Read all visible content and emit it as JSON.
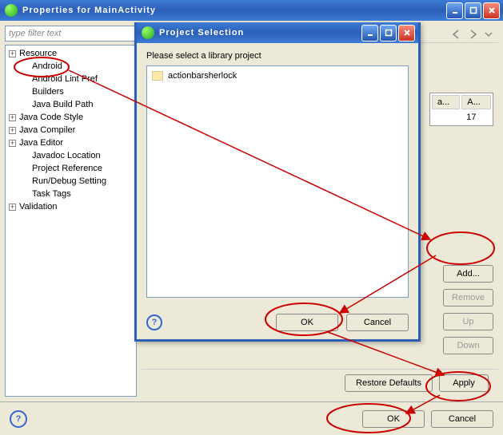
{
  "outer": {
    "title": "Properties for MainActivity",
    "filter_placeholder": "type filter text",
    "tree": [
      {
        "label": "Resource",
        "expandable": true,
        "child": false
      },
      {
        "label": "Android",
        "expandable": false,
        "child": true
      },
      {
        "label": "Android Lint Pref",
        "expandable": false,
        "child": true
      },
      {
        "label": "Builders",
        "expandable": false,
        "child": true
      },
      {
        "label": "Java Build Path",
        "expandable": false,
        "child": true
      },
      {
        "label": "Java Code Style",
        "expandable": true,
        "child": false
      },
      {
        "label": "Java Compiler",
        "expandable": true,
        "child": false
      },
      {
        "label": "Java Editor",
        "expandable": true,
        "child": false
      },
      {
        "label": "Javadoc Location",
        "expandable": false,
        "child": true
      },
      {
        "label": "Project Reference",
        "expandable": false,
        "child": true
      },
      {
        "label": "Run/Debug Setting",
        "expandable": false,
        "child": true
      },
      {
        "label": "Task Tags",
        "expandable": false,
        "child": true
      },
      {
        "label": "Validation",
        "expandable": true,
        "child": false
      }
    ],
    "table": {
      "col1": "a...",
      "col2": "A...",
      "row1": "17"
    },
    "side_buttons": {
      "add": "Add...",
      "remove": "Remove",
      "up": "Up",
      "down": "Down"
    },
    "restore_defaults": "Restore Defaults",
    "apply": "Apply",
    "ok": "OK",
    "cancel": "Cancel"
  },
  "dialog": {
    "title": "Project Selection",
    "prompt": "Please select a library project",
    "item": "actionbarsherlock",
    "ok": "OK",
    "cancel": "Cancel"
  }
}
